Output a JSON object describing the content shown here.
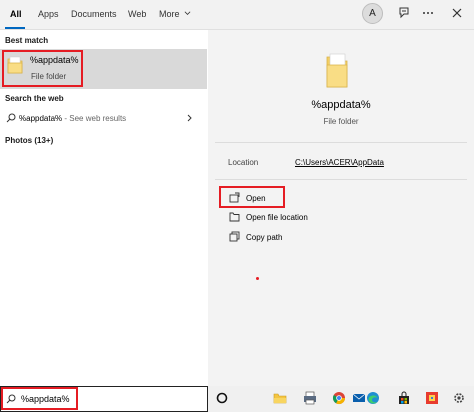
{
  "tabs": [
    {
      "label": "All"
    },
    {
      "label": "Apps"
    },
    {
      "label": "Documents"
    },
    {
      "label": "Web"
    },
    {
      "label": "More"
    }
  ],
  "account": {
    "initial": "A"
  },
  "header_icons": [
    "feedback-icon",
    "more-options-icon",
    "close-icon"
  ],
  "left": {
    "best_match_heading": "Best match",
    "best_match": {
      "title": "%appdata%",
      "subtitle": "File folder",
      "icon": "folder-icon"
    },
    "search_web_heading": "Search the web",
    "web_result": {
      "query": "%appdata%",
      "suffix": " - See web results",
      "icon": "search-icon"
    },
    "photos_heading": "Photos (13+)"
  },
  "detail": {
    "title": "%appdata%",
    "subtitle": "File folder",
    "location_label": "Location",
    "location_value": "C:\\Users\\ACER\\AppData",
    "actions": [
      {
        "label": "Open",
        "icon": "open-icon"
      },
      {
        "label": "Open file location",
        "icon": "folder-location-icon"
      },
      {
        "label": "Copy path",
        "icon": "copy-icon"
      }
    ]
  },
  "search": {
    "value": "%appdata%"
  },
  "taskbar_icons": [
    "cortana-icon",
    "file-explorer-icon",
    "printer-app-icon",
    "browser-icon",
    "mail-icon",
    "edge-icon",
    "store-icon",
    "office-icon",
    "settings-icon"
  ],
  "colors": {
    "accent": "#0067c0",
    "highlight_red": "#e51c23",
    "folder": "#f7d774"
  }
}
